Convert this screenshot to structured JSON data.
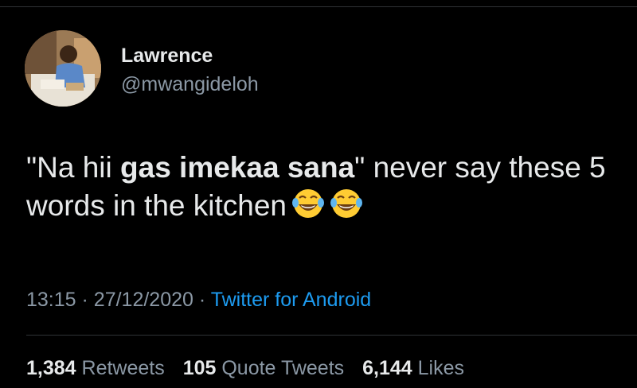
{
  "author": {
    "name": "Lawrence",
    "handle": "@mwangideloh"
  },
  "tweet": {
    "text_before": "\"Na hii ",
    "text_bold": "gas imekaa sana",
    "text_after": "\" never say these 5 words in the kitchen",
    "emojis": [
      "face-with-tears-of-joy-icon",
      "face-with-tears-of-joy-icon"
    ]
  },
  "meta": {
    "time": "13:15",
    "separator": "·",
    "date": "27/12/2020",
    "source": "Twitter for Android"
  },
  "stats": {
    "retweets_count": "1,384",
    "retweets_label": "Retweets",
    "quotes_count": "105",
    "quotes_label": "Quote Tweets",
    "likes_count": "6,144",
    "likes_label": "Likes"
  },
  "colors": {
    "background": "#000000",
    "text": "#e7e9ea",
    "secondary": "#8b98a5",
    "link": "#1d9bf0"
  }
}
